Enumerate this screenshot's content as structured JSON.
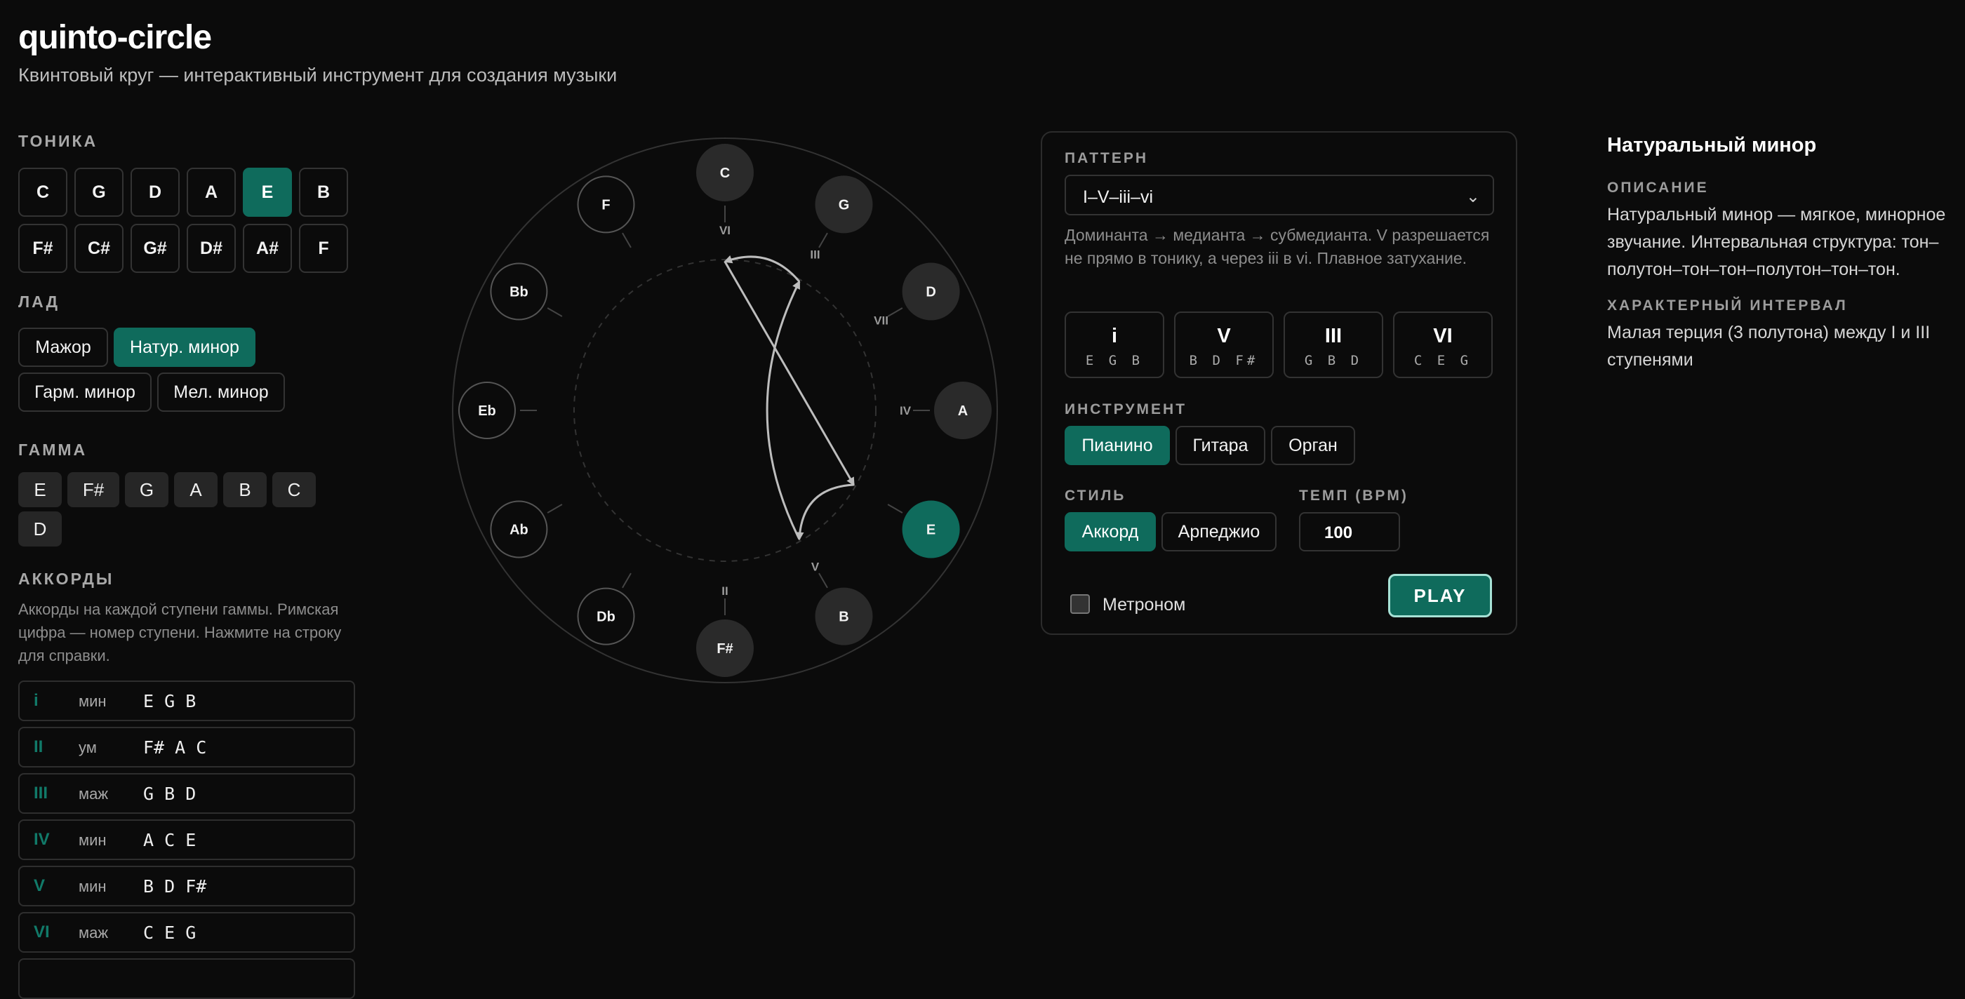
{
  "app": {
    "title": "quinto-circle",
    "subtitle": "Квинтовый круг — интерактивный инструмент для создания музыки"
  },
  "tonic": {
    "label": "ТОНИКА",
    "notes": [
      "C",
      "G",
      "D",
      "A",
      "E",
      "B",
      "F#",
      "C#",
      "G#",
      "D#",
      "A#",
      "F"
    ],
    "selected": "E"
  },
  "mode": {
    "label": "ЛАД",
    "options": [
      "Мажор",
      "Натур. минор",
      "Гарм. минор",
      "Мел. минор"
    ],
    "selected": "Натур. минор"
  },
  "scale": {
    "label": "ГАММА",
    "notes": [
      "E",
      "F#",
      "G",
      "A",
      "B",
      "C",
      "D"
    ]
  },
  "chords": {
    "label": "АККОРДЫ",
    "help": "Аккорды на каждой ступени гаммы. Римская цифра — номер ступени. Нажмите на строку для справки.",
    "rows": [
      {
        "numeral": "i",
        "quality": "мин",
        "notes": "E G B"
      },
      {
        "numeral": "II",
        "quality": "ум",
        "notes": "F# A C"
      },
      {
        "numeral": "III",
        "quality": "маж",
        "notes": "G B D"
      },
      {
        "numeral": "IV",
        "quality": "мин",
        "notes": "A C E"
      },
      {
        "numeral": "V",
        "quality": "мин",
        "notes": "B D F#"
      },
      {
        "numeral": "VI",
        "quality": "маж",
        "notes": "C E G"
      }
    ]
  },
  "circle": {
    "keys": [
      {
        "note": "C",
        "state": "scale",
        "degree": "VI"
      },
      {
        "note": "G",
        "state": "scale",
        "degree": "III"
      },
      {
        "note": "D",
        "state": "scale",
        "degree": "VII"
      },
      {
        "note": "A",
        "state": "scale",
        "degree": "IV"
      },
      {
        "note": "E",
        "state": "tonic",
        "degree": ""
      },
      {
        "note": "B",
        "state": "scale",
        "degree": "V"
      },
      {
        "note": "F#",
        "state": "scale",
        "degree": "II"
      },
      {
        "note": "Db",
        "state": "other",
        "degree": ""
      },
      {
        "note": "Ab",
        "state": "other",
        "degree": ""
      },
      {
        "note": "Eb",
        "state": "other",
        "degree": ""
      },
      {
        "note": "Bb",
        "state": "other",
        "degree": ""
      },
      {
        "note": "F",
        "state": "other",
        "degree": ""
      }
    ],
    "colors": {
      "tonic": "#0f6b5c",
      "scale": "#2a2a2a",
      "other": "#0b0b0b",
      "arrow": "#bdbdbd"
    }
  },
  "pattern": {
    "label": "ПАТТЕРН",
    "selected": "I–V–iii–vi",
    "description": "Доминанта → медианта → субмедианта. V разрешается не прямо в тонику, а через iii в vi. Плавное затухание.",
    "cards": [
      {
        "numeral": "i",
        "notes": "E G B"
      },
      {
        "numeral": "V",
        "notes": "B D F#"
      },
      {
        "numeral": "III",
        "notes": "G B D"
      },
      {
        "numeral": "VI",
        "notes": "C E G"
      }
    ]
  },
  "instrument": {
    "label": "ИНСТРУМЕНТ",
    "options": [
      "Пианино",
      "Гитара",
      "Орган"
    ],
    "selected": "Пианино"
  },
  "style": {
    "label": "СТИЛЬ",
    "options": [
      "Аккорд",
      "Арпеджио"
    ],
    "selected": "Аккорд"
  },
  "tempo": {
    "label": "ТЕМП (BPM)",
    "value": "100"
  },
  "metronome": {
    "label": "Метроном",
    "checked": false
  },
  "play": {
    "label": "PLAY"
  },
  "info": {
    "title": "Натуральный минор",
    "desc_label": "ОПИСАНИЕ",
    "desc": "Натуральный минор — мягкое, минорное звучание. Интервальная структура: тон–полутон–тон–тон–полутон–тон–тон.",
    "interval_label": "ХАРАКТЕРНЫЙ ИНТЕРВАЛ",
    "interval": "Малая терция (3 полутона) между I и III ступенями"
  },
  "accent_color": "#0f6b5c"
}
